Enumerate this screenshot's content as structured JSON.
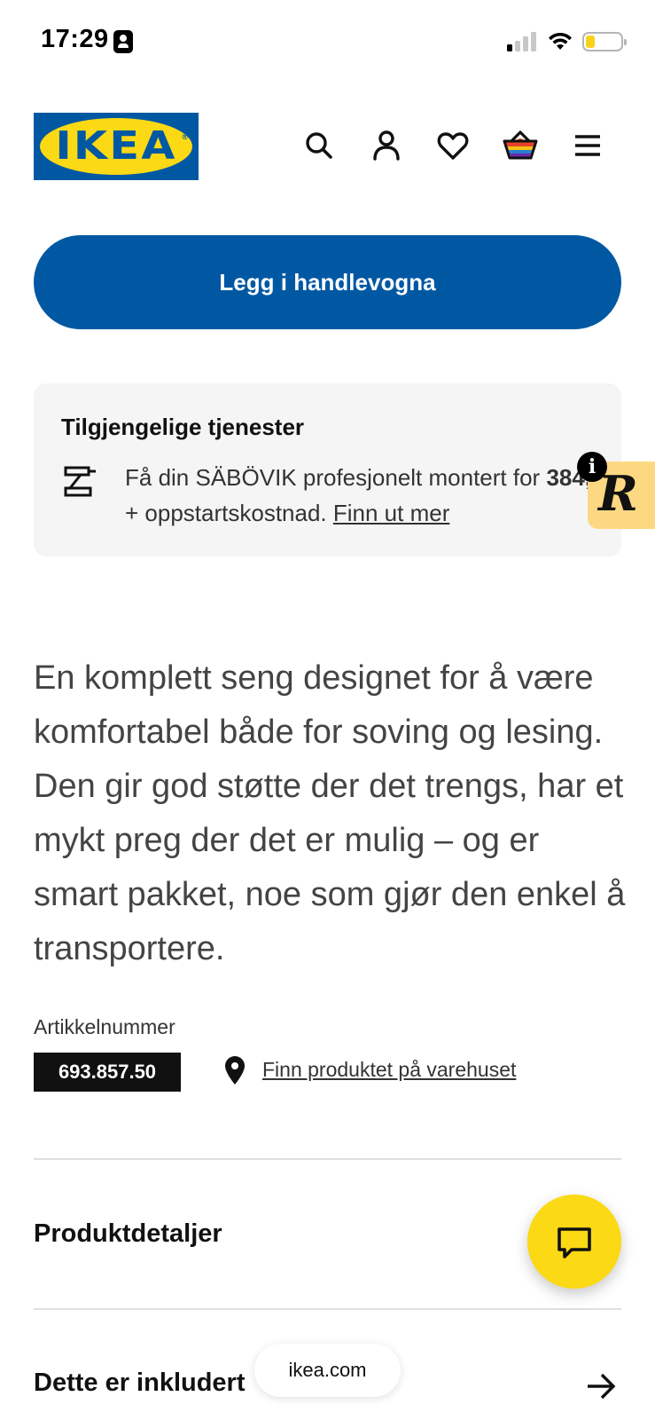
{
  "status_bar": {
    "time": "17:29",
    "signal_bars_active": 1,
    "battery_level": 0.25,
    "battery_color": "#f8d21a"
  },
  "header": {
    "logo_text": "IKEA",
    "brand_blue": "#0058a3",
    "brand_yellow": "#fbd914",
    "icons": [
      "search-icon",
      "account-icon",
      "heart-icon",
      "basket-icon",
      "menu-icon"
    ]
  },
  "cta": {
    "label": "Legg i handlevogna"
  },
  "services": {
    "title": "Tilgjengelige tjenester",
    "text_before": "Få din SÄBÖVIK profesjonelt montert for ",
    "price": "384,-",
    "text_after": " + oppstartskostnad. ",
    "link": "Finn ut mer"
  },
  "reader_badge": {
    "letter": "R",
    "info": "i"
  },
  "description": "En komplett seng designet for å være komfortabel både for soving og lesing. Den gir god støtte der det trengs, har et mykt preg der det er mulig – og er smart pakket, noe som gjør den enkel å transportere.",
  "article": {
    "label": "Artikkelnummer",
    "number": "693.857.50",
    "find_link": "Finn produktet på varehuset"
  },
  "sections": [
    {
      "label": "Produktdetaljer"
    },
    {
      "label": "Dette er inkludert"
    }
  ],
  "browser": {
    "url": "ikea.com"
  }
}
